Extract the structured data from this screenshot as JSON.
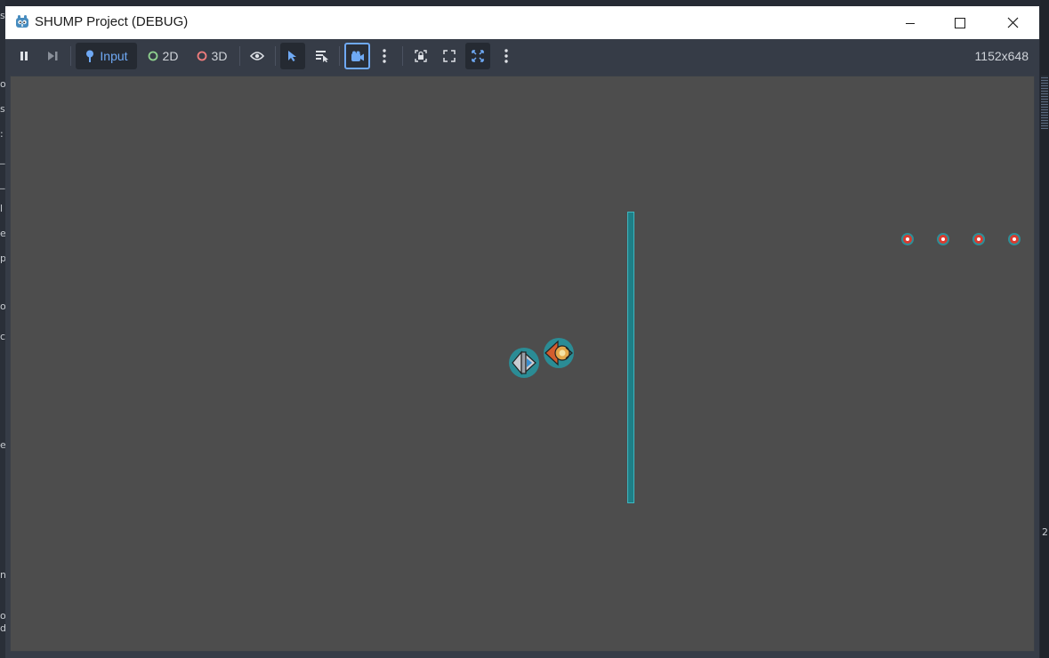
{
  "window": {
    "title": "SHUMP Project (DEBUG)",
    "controls": {
      "minimize": "minimize",
      "maximize": "maximize",
      "close": "close"
    }
  },
  "toolbar": {
    "pause_icon": "pause-icon",
    "step_icon": "step-frame-icon",
    "input_label": "Input",
    "mode_2d_label": "2D",
    "mode_3d_label": "3D",
    "resolution": "1152x648"
  },
  "game": {
    "player": "player-ship",
    "enemy": "enemy-ship",
    "barrier": "barrier",
    "pickups": [
      "pickup",
      "pickup",
      "pickup",
      "pickup"
    ]
  },
  "colors": {
    "accent": "#6fa9f4",
    "mode_2d": "#8fd18f",
    "mode_3d": "#f07d7d",
    "viewport_bg": "#4d4d4d",
    "barrier": "#1e7e86"
  }
}
